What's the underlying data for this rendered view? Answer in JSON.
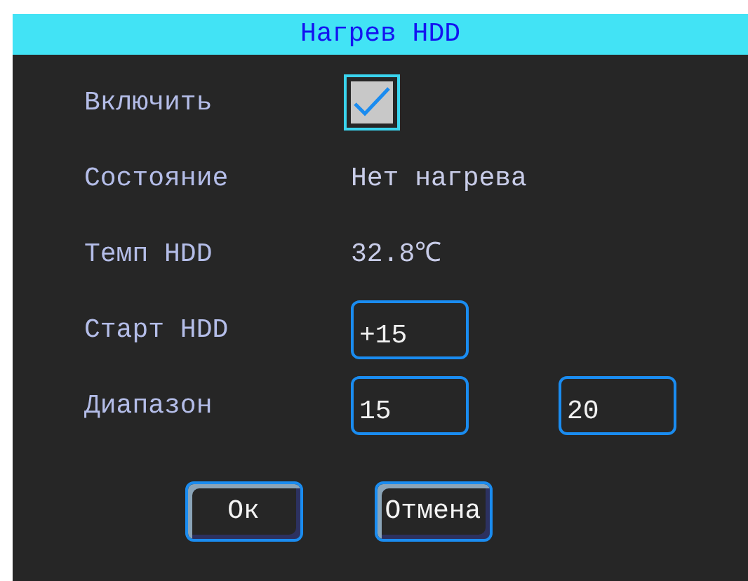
{
  "window": {
    "title": "Нагрев HDD"
  },
  "rows": [
    {
      "kind": "checkbox",
      "label": "Включить",
      "checked": true
    },
    {
      "kind": "text",
      "label": "Состояние",
      "value": "Нет нагрева"
    },
    {
      "kind": "text",
      "label": "Темп HDD",
      "value": "32.8℃"
    },
    {
      "kind": "input",
      "label": "Старт HDD",
      "values": [
        "+15"
      ]
    },
    {
      "kind": "input",
      "label": "Диапазон",
      "values": [
        "15",
        "20"
      ]
    }
  ],
  "buttons": [
    {
      "label": "Ок"
    },
    {
      "label": "Отмена"
    }
  ]
}
